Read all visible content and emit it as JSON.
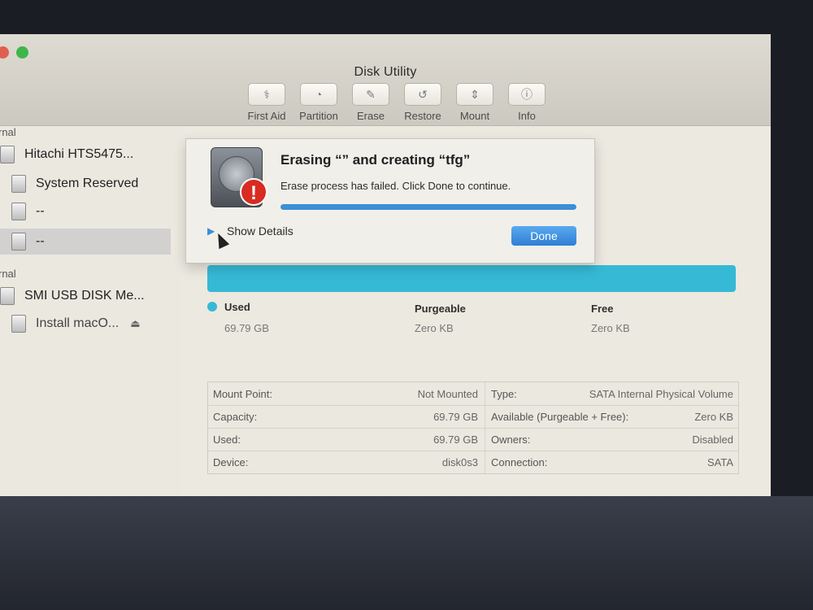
{
  "window": {
    "title": "Disk Utility"
  },
  "toolbar": {
    "items": [
      {
        "label": "First Aid",
        "icon": "stethoscope-icon"
      },
      {
        "label": "Partition",
        "icon": "pie-icon"
      },
      {
        "label": "Erase",
        "icon": "eraser-icon"
      },
      {
        "label": "Restore",
        "icon": "restore-icon"
      },
      {
        "label": "Mount",
        "icon": "mount-icon"
      },
      {
        "label": "Info",
        "icon": "info-icon"
      }
    ]
  },
  "sidebar": {
    "internal_header": "rnal",
    "external_header": "rnal",
    "items": [
      {
        "label": "Hitachi HTS5475..."
      },
      {
        "label": "System Reserved"
      },
      {
        "label": "--"
      },
      {
        "label": "--"
      },
      {
        "label": "SMI USB DISK Me..."
      },
      {
        "label": "Install macO..."
      }
    ]
  },
  "sheet": {
    "title": "Erasing “” and creating “tfg”",
    "message": "Erase process has failed. Click Done to continue.",
    "progress": 1.0,
    "show_details_label": "Show Details",
    "done_label": "Done"
  },
  "usage": {
    "used": {
      "label": "Used",
      "value": "69.79 GB"
    },
    "purgeable": {
      "label": "Purgeable",
      "value": "Zero KB"
    },
    "free": {
      "label": "Free",
      "value": "Zero KB"
    }
  },
  "info": {
    "left": [
      {
        "label": "Mount Point:",
        "value": "Not Mounted"
      },
      {
        "label": "Capacity:",
        "value": "69.79 GB"
      },
      {
        "label": "Used:",
        "value": "69.79 GB"
      },
      {
        "label": "Device:",
        "value": "disk0s3"
      }
    ],
    "right": [
      {
        "label": "Type:",
        "value": "SATA Internal Physical Volume"
      },
      {
        "label": "Available (Purgeable + Free):",
        "value": "Zero KB"
      },
      {
        "label": "Owners:",
        "value": "Disabled"
      },
      {
        "label": "Connection:",
        "value": "SATA"
      }
    ]
  },
  "colors": {
    "usage_bar": "#36b9d5",
    "accent": "#3b8fd6",
    "alert": "#d82b21"
  }
}
